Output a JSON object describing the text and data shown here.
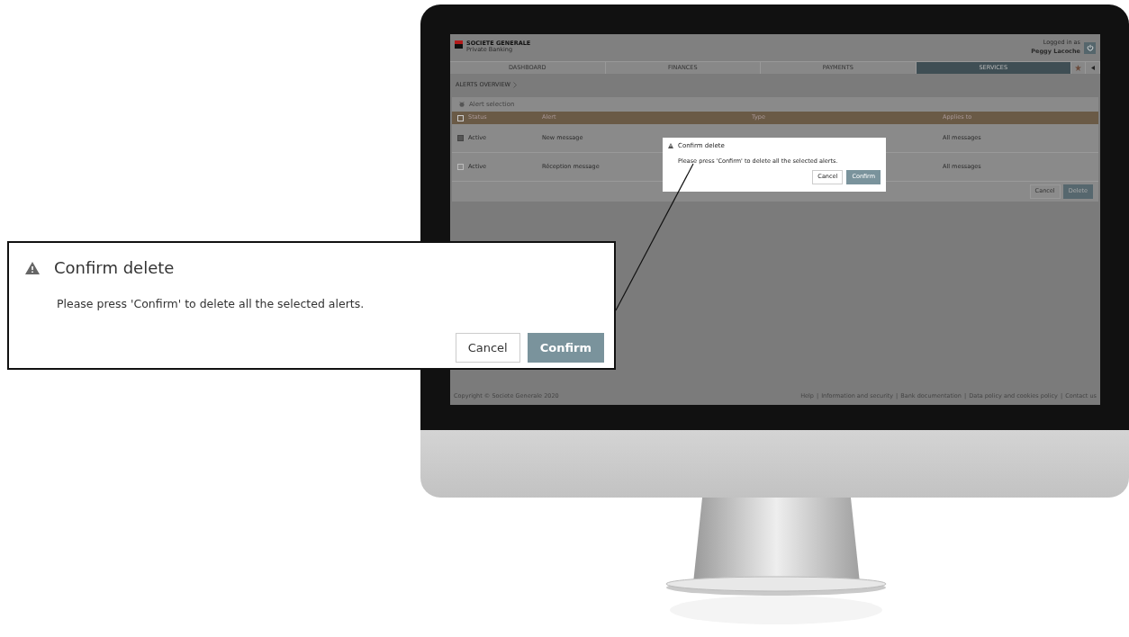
{
  "screen": {
    "header": {
      "brand": "SOCIETE GENERALE",
      "subbrand": "Private Banking",
      "login_label": "Logged in as",
      "user": "Peggy Lacoche"
    },
    "tabs": [
      {
        "label": "DASHBOARD",
        "selected": false
      },
      {
        "label": "FINANCES",
        "selected": false
      },
      {
        "label": "PAYMENTS",
        "selected": false
      },
      {
        "label": "SERVICES",
        "selected": true
      }
    ],
    "breadcrumb": "ALERTS OVERVIEW",
    "section_title": "Alert selection",
    "table": {
      "all_checked": false,
      "columns": [
        "Status",
        "Alert",
        "Type",
        "Applies to"
      ],
      "rows": [
        {
          "checked": true,
          "status": "Active",
          "alert": "New message",
          "applies_to": "All messages"
        },
        {
          "checked": false,
          "status": "Active",
          "alert": "Réception message",
          "applies_to": "All messages"
        }
      ]
    },
    "actions": [
      {
        "label": "Cancel",
        "kind": "secondary"
      },
      {
        "label": "Delete",
        "kind": "primary"
      }
    ],
    "dialog": {
      "title": "Confirm delete",
      "message": "Please press 'Confirm' to delete all the selected alerts.",
      "buttons": [
        {
          "label": "Cancel",
          "kind": "secondary"
        },
        {
          "label": "Confirm",
          "kind": "primary"
        }
      ]
    },
    "footer": {
      "copyright": "Copyright © Societe Generale 2020",
      "separator": "|",
      "links": [
        "Help",
        "Information and security",
        "Bank documentation",
        "Data policy and cookies policy",
        "Contact us"
      ]
    }
  },
  "callout": {
    "title": "Confirm delete",
    "message": "Please press 'Confirm' to delete all the selected alerts.",
    "buttons": [
      {
        "label": "Cancel",
        "kind": "secondary"
      },
      {
        "label": "Confirm",
        "kind": "primary"
      }
    ]
  }
}
